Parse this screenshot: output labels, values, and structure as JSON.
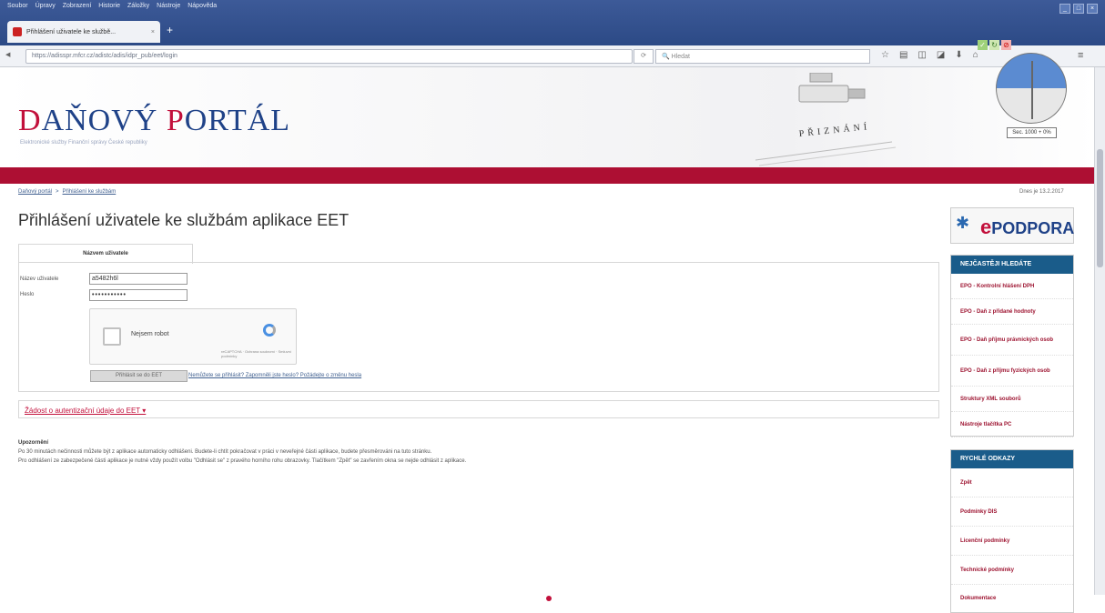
{
  "browser": {
    "menu": [
      "Soubor",
      "Úpravy",
      "Zobrazení",
      "Historie",
      "Záložky",
      "Nástroje",
      "Nápověda"
    ],
    "tab_title": "Přihlášení uživatele ke službě...",
    "url": "https://adisspr.mfcr.cz/adistc/adis/idpr_pub/eet/login",
    "search_placeholder": "Hledat",
    "window_controls": [
      "_",
      "□",
      "×"
    ]
  },
  "header": {
    "logo_first": "DAŇOVÝ",
    "logo_second": "PORTÁL",
    "subtitle": "Elektronické služby Finanční správy České republiky",
    "stamp": "PŘIZNÁNÍ"
  },
  "clock": {
    "label": "Sec. 1000 + 0%"
  },
  "breadcrumb": {
    "home": "Daňový portál",
    "sep": ">",
    "current": "Přihlášení ke službám"
  },
  "date_text": "Dnes je 13.2.2017",
  "page_title": "Přihlášení uživatele ke službám aplikace EET",
  "login": {
    "tab_label": "Názvem uživatele",
    "user_label": "Název uživatele",
    "user_value": "a5482h6l",
    "pass_label": "Heslo",
    "pass_value": "•••••••••••",
    "captcha_text": "Nejsem robot",
    "captcha_small": "reCAPTCHA · Ochrana soukromí · Smluvní podmínky",
    "submit_label": "Přihlásit se do EET",
    "links_text": "Nemůžete se přihlásit? Zapomněli jste heslo? Požádejte o změnu hesla"
  },
  "request_link": "Žádost o autentizační údaje do EET ▾",
  "notice": {
    "title": "Upozornění",
    "line1": "Po 30 minutách nečinnosti můžete být z aplikace automaticky odhlášeni. Budete-li chtít pokračovat v práci v neveřejné části aplikace, budete přesměrováni na tuto stránku.",
    "line2": "Pro odhlášení ze zabezpečené části aplikace je nutné vždy použít volbu \"Odhlásit se\" z pravého horního rohu obrazovky. Tlačítkem \"Zpět\" se zavřením okna se nejde odhlásit z aplikace."
  },
  "sidebar": {
    "epodpora": "PODPORA",
    "epodpora_e": "e",
    "frequent_title": "NEJČASTĚJI HLEDÁTE",
    "frequent": [
      "EPO - Kontrolní hlášení DPH",
      "EPO - Daň z přidané hodnoty",
      "EPO - Daň příjmu právnických osob",
      "EPO - Daň z příjmu fyzických osob",
      "Struktury XML souborů",
      "Nástroje tlačítka PC"
    ],
    "quick_title": "RYCHLÉ ODKAZY",
    "quick": [
      "Zpět",
      "Podmínky DIS",
      "Licenční podmínky",
      "Technické podmínky",
      "Dokumentace"
    ]
  }
}
